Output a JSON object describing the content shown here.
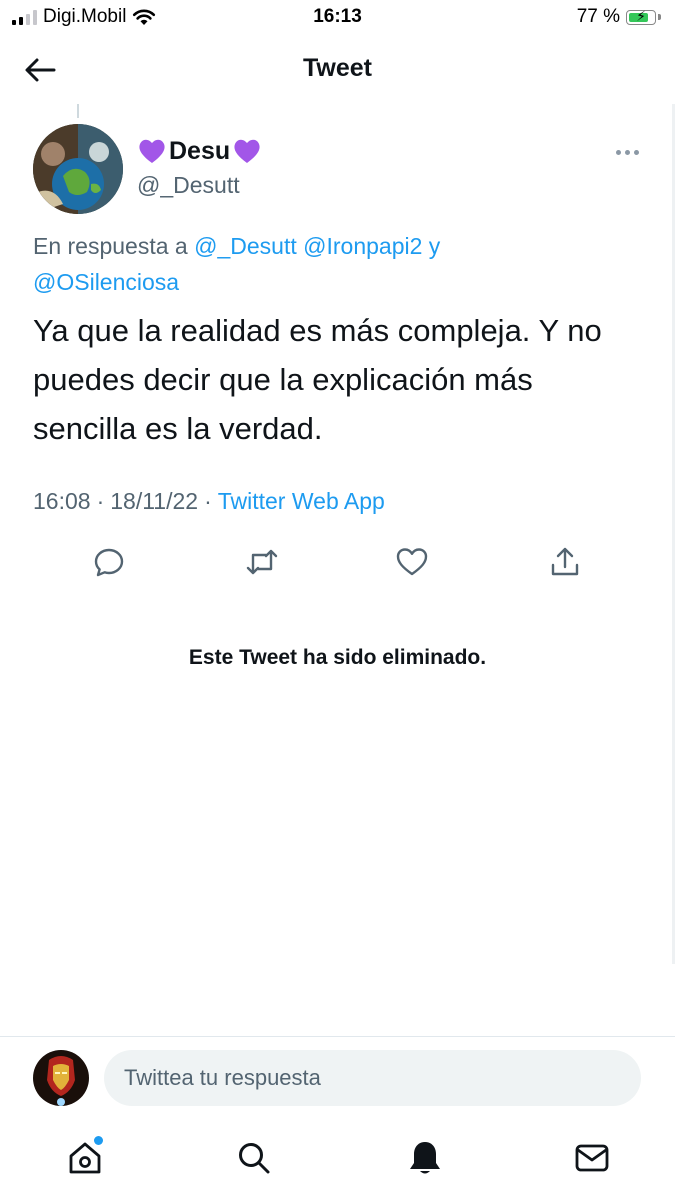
{
  "status_bar": {
    "carrier": "Digi.Mobil",
    "time": "16:13",
    "battery": "77 %",
    "battery_level": 0.77
  },
  "header": {
    "title": "Tweet"
  },
  "tweet": {
    "display_name": "Desu",
    "handle": "@_Desutt",
    "reply_prefix": "En respuesta a",
    "reply_mentions": [
      "@_Desutt",
      "@Ironpapi2"
    ],
    "reply_joiner": "y",
    "reply_last": "@OSilenciosa",
    "text": "Ya que la realidad es más compleja. Y no puedes decir que la explicación más sencilla es la verdad.",
    "time": "16:08",
    "date": "18/11/22",
    "source": "Twitter Web App",
    "meta_sep": "·",
    "accent_color": "#1d9bf0",
    "heart_emoji_color": "#a256e8"
  },
  "actions": {
    "icons": [
      "reply-icon",
      "retweet-icon",
      "like-icon",
      "share-icon"
    ]
  },
  "deleted_notice": "Este Tweet ha sido eliminado.",
  "reply_bar": {
    "placeholder": "Twittea tu respuesta"
  },
  "bottom_nav": {
    "icons": [
      "home-icon",
      "search-icon",
      "notifications-icon",
      "messages-icon"
    ]
  }
}
